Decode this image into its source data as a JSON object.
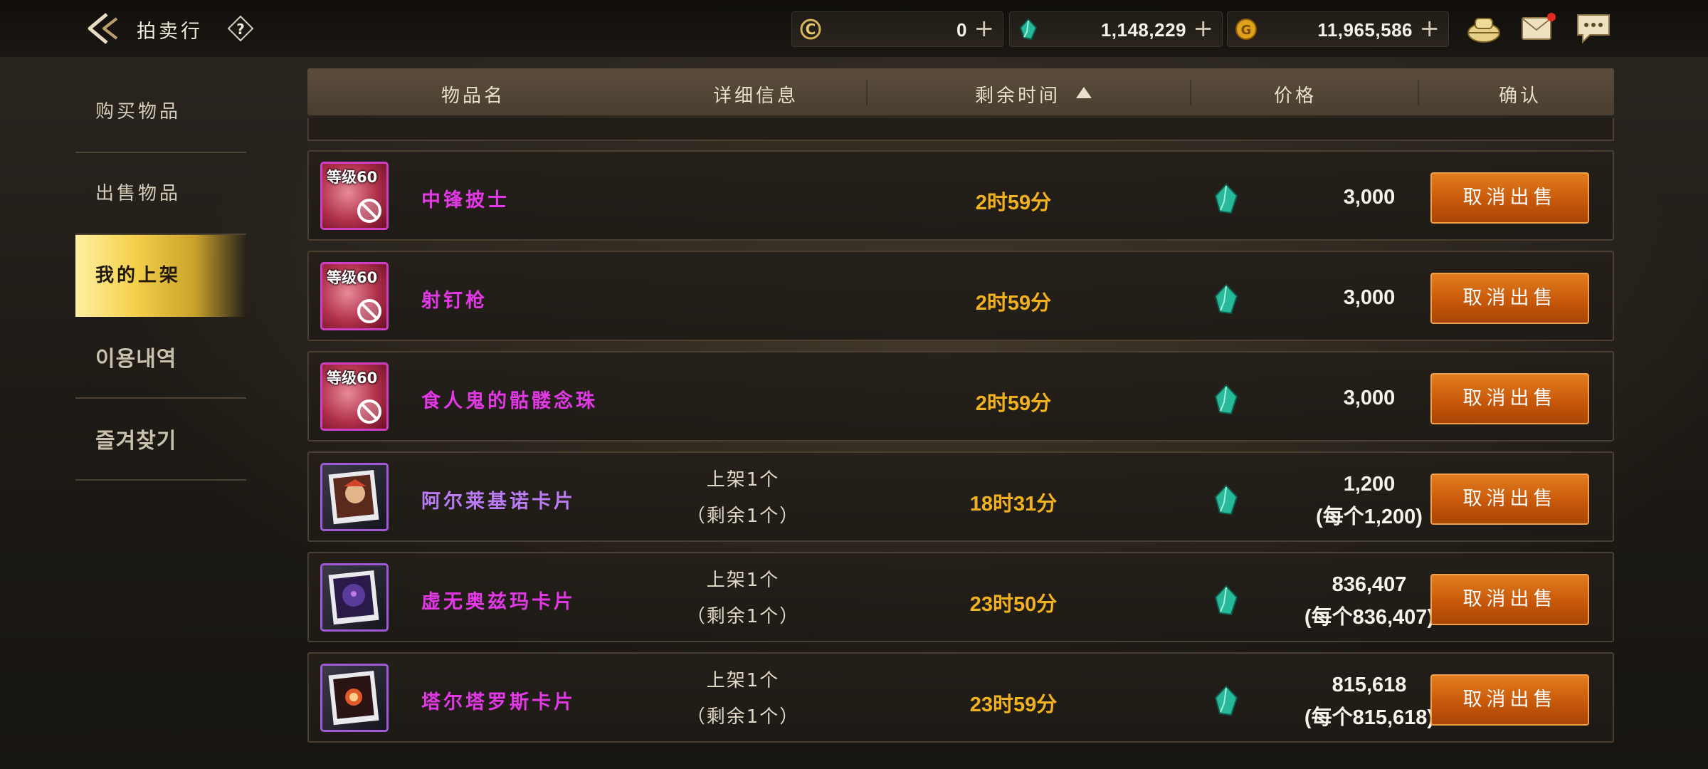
{
  "header": {
    "title": "拍卖行",
    "help_label": "?",
    "currencies": [
      {
        "icon": "coin-c-icon",
        "value": "0"
      },
      {
        "icon": "green-gem-icon",
        "value": "1,148,229"
      },
      {
        "icon": "gold-coin-icon",
        "value": "11,965,586"
      }
    ],
    "plus": "+"
  },
  "sidebar": {
    "items": [
      {
        "label": "购买物品"
      },
      {
        "label": "出售物品"
      },
      {
        "label": "我的上架",
        "active": true
      },
      {
        "label": "이용내역"
      },
      {
        "label": "즐겨찾기"
      }
    ]
  },
  "table": {
    "columns": {
      "name": "物品名",
      "detail": "详细信息",
      "time": "剩余时间",
      "price": "价格",
      "confirm": "确认"
    },
    "rows": [
      {
        "name": "中锋披士",
        "level": "等级60",
        "detail1": "",
        "detail2": "",
        "time": "2时59分",
        "price": "3,000",
        "price_each": "",
        "action": "取消出售"
      },
      {
        "name": "射钉枪",
        "level": "等级60",
        "detail1": "",
        "detail2": "",
        "time": "2时59分",
        "price": "3,000",
        "price_each": "",
        "action": "取消出售"
      },
      {
        "name": "食人鬼的骷髅念珠",
        "level": "等级60",
        "detail1": "",
        "detail2": "",
        "time": "2时59分",
        "price": "3,000",
        "price_each": "",
        "action": "取消出售"
      },
      {
        "name": "阿尔莱基诺卡片",
        "level": "",
        "detail1": "上架1个",
        "detail2": "（剩余1个）",
        "time": "18时31分",
        "price": "1,200",
        "price_each": "(每个1,200)",
        "action": "取消出售"
      },
      {
        "name": "虚无奥兹玛卡片",
        "level": "",
        "detail1": "上架1个",
        "detail2": "（剩余1个）",
        "time": "23时50分",
        "price": "836,407",
        "price_each": "(每个836,407)",
        "action": "取消出售"
      },
      {
        "name": "塔尔塔罗斯卡片",
        "level": "",
        "detail1": "上架1个",
        "detail2": "（剩余1个）",
        "time": "23时59分",
        "price": "815,618",
        "price_each": "(每个815,618)",
        "action": "取消出售"
      }
    ]
  },
  "colors": {
    "accent_gold": "#f2b11f",
    "item_magenta": "#e238e6",
    "item_purple": "#b97cf5",
    "button_orange": "#d8660f",
    "active_tab": "#f4cf4a"
  }
}
